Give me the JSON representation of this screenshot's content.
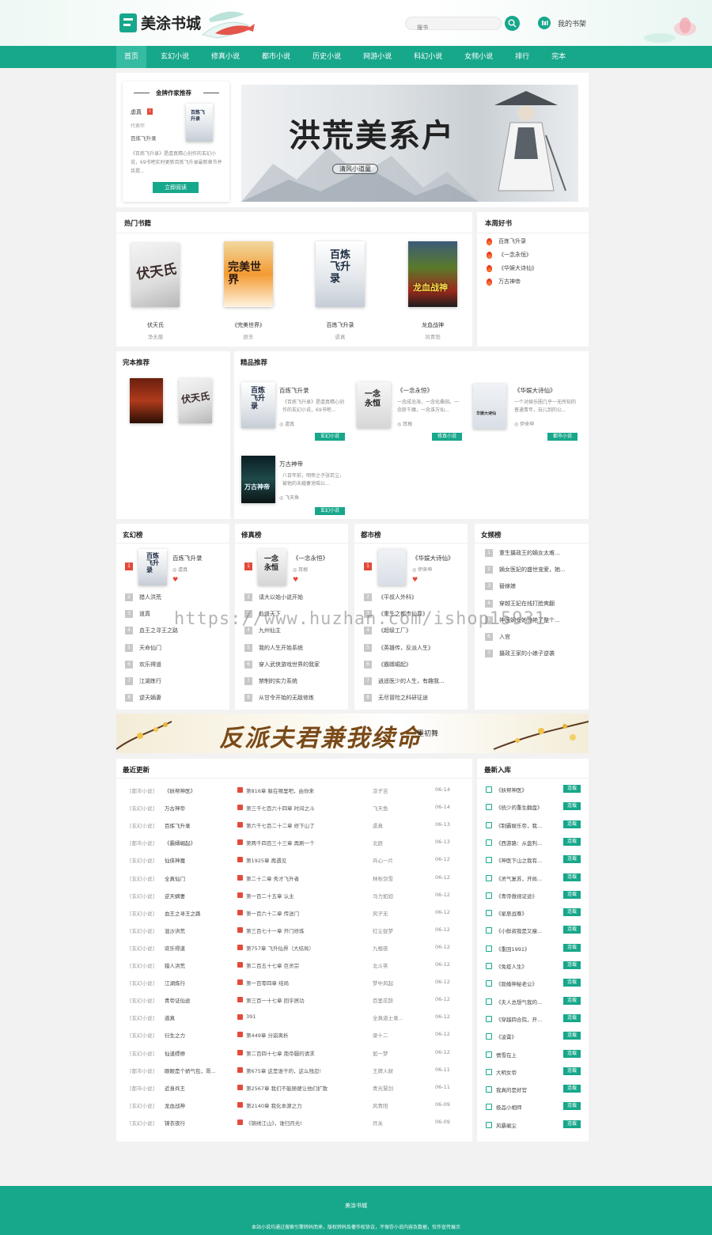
{
  "header": {
    "logo_text": "美涂书城",
    "search_placeholder": "搜书",
    "bookshelf_label": "我的书架"
  },
  "nav": {
    "items": [
      "首页",
      "玄幻小说",
      "修真小说",
      "都市小说",
      "历史小说",
      "网游小说",
      "科幻小说",
      "女频小说",
      "排行",
      "完本"
    ]
  },
  "author_rec": {
    "title": "金牌作家推荐",
    "author": "虐真",
    "badge": "I",
    "label": "代表作",
    "book": "百炼飞升录",
    "desc": "《百炼飞升录》是虐真精心创作的玄幻小说，69书吧实时更新百炼飞升录最新章节并且提...",
    "button": "立即阅读",
    "cover_title": "百炼飞升录"
  },
  "banner": {
    "title": "洪荒美系户",
    "subtitle": "清风小道童"
  },
  "hot_books": {
    "title": "热门书籍",
    "items": [
      {
        "name": "伏天氏",
        "author": "净无痕",
        "cover": "伏天氏"
      },
      {
        "name": "《完美世界》",
        "author": "辰东",
        "cover": "完美世界"
      },
      {
        "name": "百炼飞升录",
        "author": "虐真",
        "cover": "百炼飞升录"
      },
      {
        "name": "龙血战神",
        "author": "风青阳",
        "cover": "龙血战神"
      }
    ]
  },
  "weekly": {
    "title": "本周好书",
    "items": [
      "百炼飞升录",
      "《一念永恒》",
      "《华娱大诗仙》",
      "万古神帝"
    ]
  },
  "finished": {
    "title": "完本推荐"
  },
  "featured": {
    "title": "精品推荐",
    "items": [
      {
        "name": "百炼飞升录",
        "desc": "《百炼飞升录》是虐真精心创作的玄幻小说，69书吧...",
        "author": "虐真",
        "tag": "玄幻小说",
        "cover": "百炼飞升录"
      },
      {
        "name": "《一念永恒》",
        "desc": "一念成沧海，一念化桑田。一念斩千魔，一念诛万仙...",
        "author": "耳根",
        "tag": "修真小说",
        "cover": "一念永恒"
      },
      {
        "name": "《华娱大诗仙》",
        "desc": "一个对娱乐圈几乎一无所知的普通青年，玩儿到的公...",
        "author": "伊来坤",
        "tag": "都市小说",
        "cover": "华娱大诗仙"
      },
      {
        "name": "万古神帝",
        "desc": "八百年前，明帝之子张若尘，被他的未婚妻池瑶公...",
        "author": "飞天鱼",
        "tag": "玄幻小说",
        "cover": "万古神帝"
      }
    ]
  },
  "rank_xuanhuan": {
    "title": "玄幻榜",
    "top": {
      "name": "百炼飞升录",
      "author": "虐真"
    },
    "items": [
      "猎人洪荒",
      "道真",
      "血王之寻王之路",
      "天命仙门",
      "欢乐得道",
      "江湖炼行",
      "逆天嫡妻"
    ]
  },
  "rank_xiuzhen": {
    "title": "修真榜",
    "top": {
      "name": "《一念永恒》",
      "author": "耳根"
    },
    "items": [
      "请大以始小说开始",
      "仙道天下",
      "九州仙主",
      "我的人生开始系统",
      "穿入武侠游戏世界的我家",
      "禁制的实力系统",
      "从甘令开始的无敌修炼"
    ]
  },
  "rank_dushi": {
    "title": "都市榜",
    "top": {
      "name": "《华娱大诗仙》",
      "author": "伊来坤"
    },
    "items": [
      "《平叔人外科》",
      "《重生之都市仙尊》",
      "《超级工厂》",
      "《英雄传，反派人生》",
      "《霸婿崛起》",
      "逍遥医少的人生，有趣我...",
      "无尽冒险之科研征途"
    ]
  },
  "rank_nvpin": {
    "title": "女频榜",
    "items": [
      "重生摄政王的嫡女太难...",
      "嫡女医妃的盛世宠爱，她...",
      "替嫁娘",
      "穿越王妃在线打脸爽翻",
      "神医嫡女她惊艳了整个...",
      "入宫",
      "摄政王家的小娘子逆袭"
    ]
  },
  "banner2": {
    "title": "反派夫君兼我续命",
    "author": "墨初舞"
  },
  "updates": {
    "title": "最近更新",
    "rows": [
      {
        "cat": "[都市小说]",
        "book": "《妖帮神医》",
        "chapter": "第816章 躲在哪里吧，由你来",
        "author": "凉子吉",
        "date": "06-14"
      },
      {
        "cat": "[玄幻小说]",
        "book": "万古神帝",
        "chapter": "第三千七百六十四章 时间之斗",
        "author": "飞天鱼",
        "date": "06-14"
      },
      {
        "cat": "[玄幻小说]",
        "book": "百炼飞升录",
        "chapter": "第六千七百二十二章 修下山了",
        "author": "虐真",
        "date": "06-13"
      },
      {
        "cat": "[都市小说]",
        "book": "《霸婿崛起》",
        "chapter": "第两千四百三十三章 再刷一个",
        "author": "北辰",
        "date": "06-13"
      },
      {
        "cat": "[玄幻小说]",
        "book": "仙侠神魔",
        "chapter": "第1925章 再遇见",
        "author": "兵心一片",
        "date": "06-12"
      },
      {
        "cat": "[玄幻小说]",
        "book": "全真仙门",
        "chapter": "第二十二章 秀才飞升者",
        "author": "林秋剑雪",
        "date": "06-12"
      },
      {
        "cat": "[玄幻小说]",
        "book": "逆天嫡妻",
        "chapter": "第一百二十五章 认主",
        "author": "马力如如",
        "date": "06-12"
      },
      {
        "cat": "[玄幻小说]",
        "book": "血王之寻王之路",
        "chapter": "第一百六十二章 传送门",
        "author": "风子无",
        "date": "06-12"
      },
      {
        "cat": "[玄幻小说]",
        "book": "混沙洪荒",
        "chapter": "第三百七十一章 开门修炼",
        "author": "红尘捉梦",
        "date": "06-12"
      },
      {
        "cat": "[玄幻小说]",
        "book": "欢乐得道",
        "chapter": "第757章 飞升仙界（大结局）",
        "author": "九棍夜",
        "date": "06-12"
      },
      {
        "cat": "[玄幻小说]",
        "book": "猎人洪荒",
        "chapter": "第二百五十七章 巨灵宗",
        "author": "北斗笑",
        "date": "06-12"
      },
      {
        "cat": "[玄幻小说]",
        "book": "江湖炼行",
        "chapter": "第一百零四章 结局",
        "author": "梦中风起",
        "date": "06-12"
      },
      {
        "cat": "[玄幻小说]",
        "book": "青帝证仙途",
        "chapter": "第三百一十七章 回乎居功",
        "author": "百里花辞",
        "date": "06-12"
      },
      {
        "cat": "[玄幻小说]",
        "book": "道真",
        "chapter": "391",
        "author": "全真道士录...",
        "date": "06-12"
      },
      {
        "cat": "[玄幻小说]",
        "book": "衍生之力",
        "chapter": "第449章 分崩离析",
        "author": "梁十二",
        "date": "06-12"
      },
      {
        "cat": "[玄幻小说]",
        "book": "仙道缥缈",
        "chapter": "第二百四十七章 南帝疆的请求",
        "author": "如一梦",
        "date": "06-12"
      },
      {
        "cat": "[都市小说]",
        "book": "眼眼是个娇气包，哥...",
        "chapter": "第675章 这是谁干的，这么残忍!",
        "author": "王牌人财",
        "date": "06-11"
      },
      {
        "cat": "[都市小说]",
        "book": "近身兵王",
        "chapter": "第2567章 我们不能随便让他们扩散",
        "author": "青光慧剑",
        "date": "06-11"
      },
      {
        "cat": "[玄幻小说]",
        "book": "龙血战神",
        "chapter": "第2140章 我化本源之力",
        "author": "风青阳",
        "date": "06-09"
      },
      {
        "cat": "[玄幻小说]",
        "book": "锦衣夜行",
        "chapter": "《锦绣江山》，谁归月光!",
        "author": "月关",
        "date": "06-09"
      }
    ]
  },
  "new_books": {
    "title": "最新入库",
    "items": [
      {
        "name": "《妖帮神医》",
        "status": "连载"
      },
      {
        "name": "《统少的重生翻盘》",
        "status": "连载"
      },
      {
        "name": "《制霸娱乐帝，我...",
        "status": "连载"
      },
      {
        "name": "《西游路：从盘判...",
        "status": "连载"
      },
      {
        "name": "《神医下山之我有...",
        "status": "连载"
      },
      {
        "name": "《灵气复苏，开局...",
        "status": "连载"
      },
      {
        "name": "《青帝傲视证途》",
        "status": "连载"
      },
      {
        "name": "《星辰战尊》",
        "status": "连载"
      },
      {
        "name": "《小鲜叔我是又瘦...",
        "status": "连载"
      },
      {
        "name": "《重回1991》",
        "status": "连载"
      },
      {
        "name": "《免疫人生》",
        "status": "连载"
      },
      {
        "name": "《隐婚神秘老公》",
        "status": "连载"
      },
      {
        "name": "《夫人总想气我的...",
        "status": "连载"
      },
      {
        "name": "《穿越四合院，开...",
        "status": "连载"
      },
      {
        "name": "《凌霄》",
        "status": "连载"
      },
      {
        "name": "情雪在上",
        "status": "连载"
      },
      {
        "name": "大明女帝",
        "status": "连载"
      },
      {
        "name": "我真的是好官",
        "status": "连载"
      },
      {
        "name": "极品小相师",
        "status": "连载"
      },
      {
        "name": "风暴崛尘",
        "status": "连载"
      }
    ]
  },
  "footer": {
    "title": "美涂书城",
    "notice": "本站小说均通过搜索引擎转码而来，版权转码及著作权协议，不保存小说内容及数据，仅作宣传展示"
  },
  "watermark": "https://www.huzhan.com/ishop15931",
  "colors": {
    "accent": "#17a78b",
    "hot": "#e34a3a"
  }
}
